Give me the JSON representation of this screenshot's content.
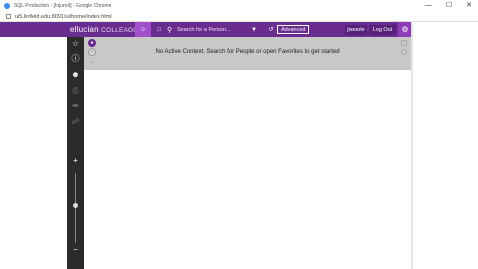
{
  "window": {
    "title": "SQL Production - [Injured] - Google Chrome",
    "url": "ui5.linfield.edu:8091/ui/home/index.html",
    "controls": {
      "minimize": "—",
      "maximize": "☐",
      "close": "✕"
    }
  },
  "header": {
    "brand_main": "ellucian",
    "brand_sub": "COLLEAGU",
    "search_placeholder": "Search for a Person...",
    "advanced_label": "Advanced",
    "user_label": "jisearle",
    "logout_label": "Log Out",
    "accent_color": "#6a2c8e"
  },
  "sidebar": {
    "icons": [
      "star-icon",
      "help-icon",
      "person-icon",
      "print-icon",
      "share-icon",
      "paperclip-icon"
    ],
    "zoom_in": "+",
    "zoom_out": "−"
  },
  "context": {
    "message": "No Active Context. Search for People or open Favorites to get started"
  }
}
